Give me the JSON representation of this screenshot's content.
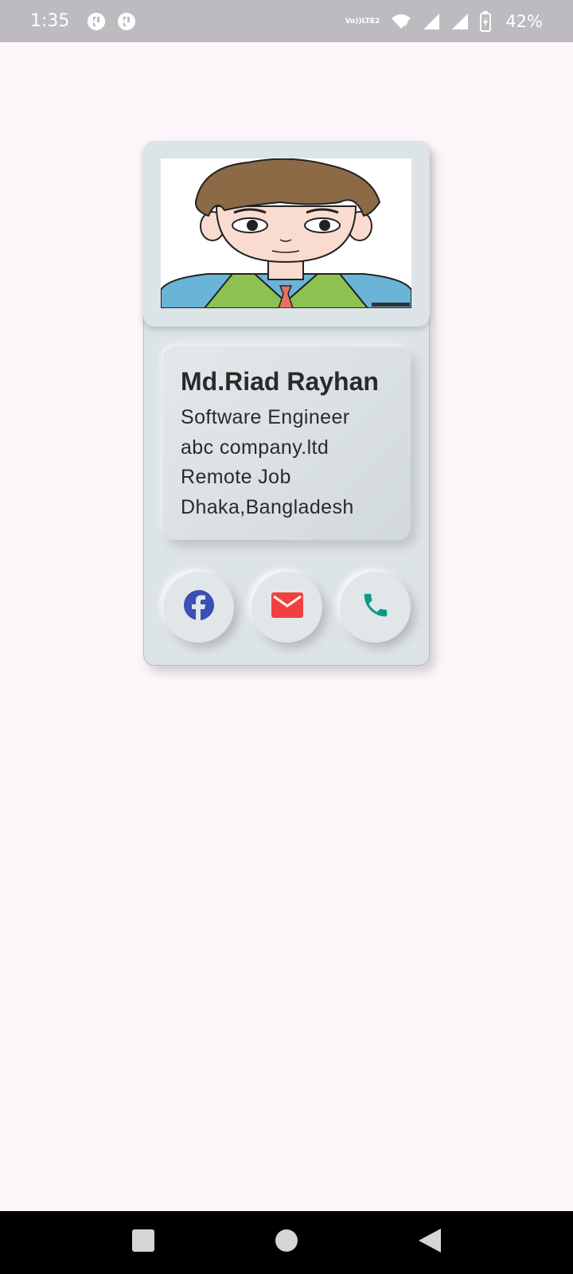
{
  "status_bar": {
    "time": "1:35",
    "network_label": "LTE2",
    "volte_label": "Vo))",
    "battery_percent": "42%",
    "notification_icons": [
      "flutter-app-icon",
      "flutter-app-icon"
    ],
    "system_icons": [
      "volte-icon",
      "wifi-icon",
      "signal-icon",
      "signal-icon",
      "battery-charging-icon"
    ]
  },
  "profile": {
    "name": "Md.Riad Rayhan",
    "lines": [
      "Software Engineer",
      "abc company.ltd",
      "Remote Job",
      "Dhaka,Bangladesh"
    ],
    "avatar_icon": "cartoon-boy-avatar"
  },
  "actions": [
    {
      "icon": "facebook-icon",
      "color": "#3b4fb8"
    },
    {
      "icon": "email-icon",
      "color": "#f0413f"
    },
    {
      "icon": "phone-icon",
      "color": "#0e9a8a"
    }
  ],
  "nav_bar": {
    "buttons": [
      "recents-icon",
      "home-icon",
      "back-icon"
    ]
  },
  "colors": {
    "background": "#fdf7fb",
    "card": "#dde4e7",
    "status_bar": "#bdbbbf"
  }
}
